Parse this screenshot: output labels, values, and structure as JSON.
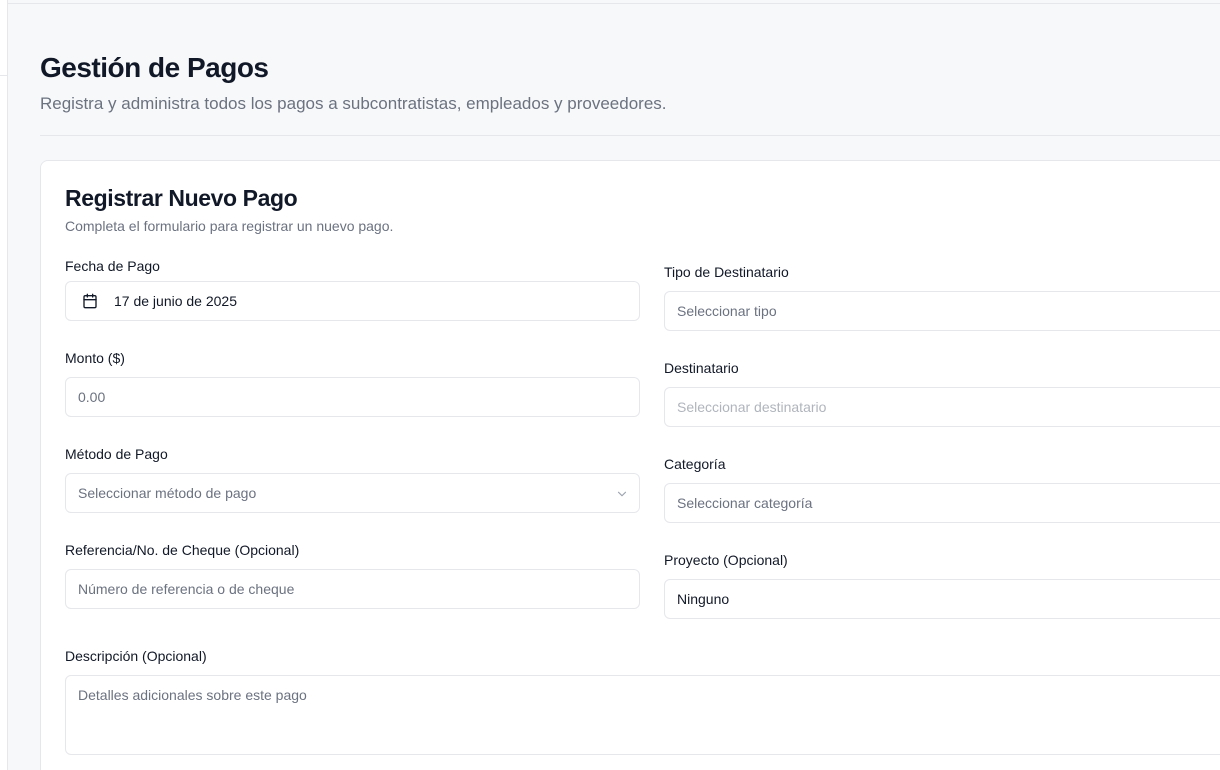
{
  "page": {
    "title": "Gestión de Pagos",
    "subtitle": "Registra y administra todos los pagos a subcontratistas, empleados y proveedores."
  },
  "form": {
    "title": "Registrar Nuevo Pago",
    "description": "Completa el formulario para registrar un nuevo pago.",
    "fecha": {
      "label": "Fecha de Pago",
      "value": "17 de junio de 2025",
      "icon": "calendar-icon"
    },
    "monto": {
      "label": "Monto ($)",
      "placeholder": "0.00"
    },
    "metodo": {
      "label": "Método de Pago",
      "placeholder": "Seleccionar método de pago"
    },
    "referencia": {
      "label": "Referencia/No. de Cheque (Opcional)",
      "placeholder": "Número de referencia o de cheque"
    },
    "tipo": {
      "label": "Tipo de Destinatario",
      "placeholder": "Seleccionar tipo"
    },
    "destinatario": {
      "label": "Destinatario",
      "placeholder": "Seleccionar destinatario"
    },
    "categoria": {
      "label": "Categoría",
      "placeholder": "Seleccionar categoría"
    },
    "proyecto": {
      "label": "Proyecto (Opcional)",
      "value": "Ninguno"
    },
    "descripcion": {
      "label": "Descripción (Opcional)",
      "placeholder": "Detalles adicionales sobre este pago"
    }
  },
  "colors": {
    "background": "#f7f8f9",
    "card": "#ffffff",
    "border": "#e5e7eb",
    "text": "#111827",
    "muted_text": "#6b7280"
  }
}
